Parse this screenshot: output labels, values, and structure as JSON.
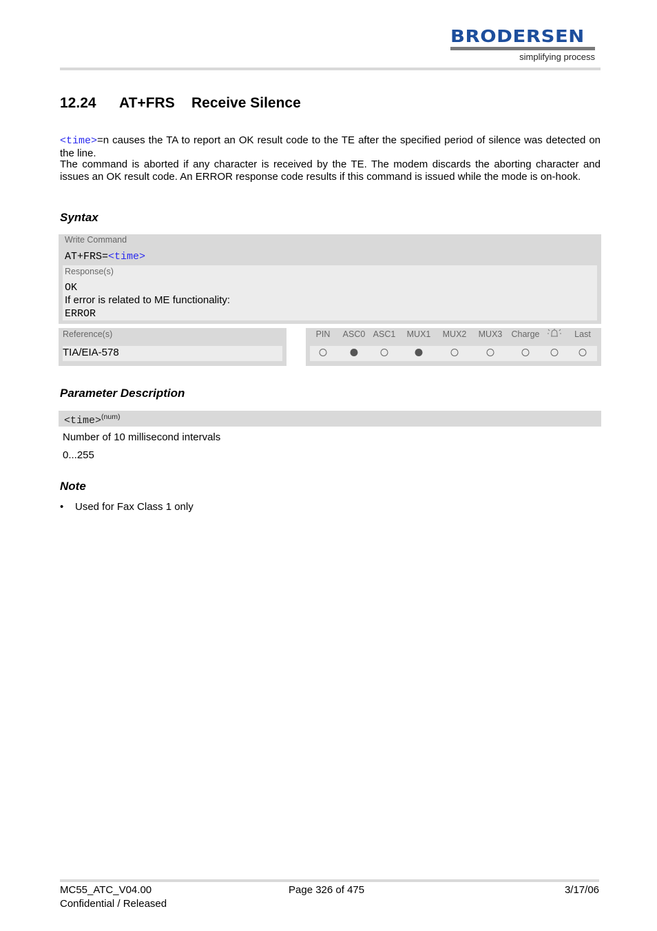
{
  "header": {
    "logo_brand": "BRODERSEN",
    "logo_tagline": "simplifying process",
    "brand_color": "#1d4e9c"
  },
  "section": {
    "number": "12.24",
    "command": "AT+FRS",
    "title": "Receive Silence"
  },
  "intro": {
    "param_ref": "<time>",
    "line1_rest": "=n causes the TA to report an OK result code to the TE after the specified period of silence was detected on the line.",
    "line2": "The command is aborted if any character is received by the TE. The modem discards the aborting character and issues an OK result code. An ERROR response code results if this command is issued while the mode is on-hook."
  },
  "syntax": {
    "heading": "Syntax",
    "write_command_label": "Write Command",
    "write_command_prefix": "AT+FRS=",
    "write_command_param": "<time>",
    "responses_label": "Response(s)",
    "response_ok": "OK",
    "response_condition": "If error is related to ME functionality:",
    "response_error": "ERROR",
    "references_label": "Reference(s)",
    "reference_value": "TIA/EIA-578",
    "flags": [
      {
        "label": "PIN",
        "active": false
      },
      {
        "label": "ASC0",
        "active": true
      },
      {
        "label": "ASC1",
        "active": false
      },
      {
        "label": "MUX1",
        "active": true
      },
      {
        "label": "MUX2",
        "active": false
      },
      {
        "label": "MUX3",
        "active": false
      },
      {
        "label": "Charge",
        "active": false
      },
      {
        "label": "alarm-icon",
        "active": false
      },
      {
        "label": "Last",
        "active": false
      }
    ]
  },
  "parameters": {
    "heading": "Parameter Description",
    "items": [
      {
        "name": "<time>",
        "type": "(num)",
        "description": "Number of 10 millisecond intervals",
        "range": "0...255"
      }
    ]
  },
  "note": {
    "heading": "Note",
    "bullet": "•",
    "items": [
      "Used for Fax Class 1 only"
    ]
  },
  "footer": {
    "document": "MC55_ATC_V04.00",
    "page": "Page 326 of 475",
    "date": "3/17/06",
    "status": "Confidential / Released"
  }
}
